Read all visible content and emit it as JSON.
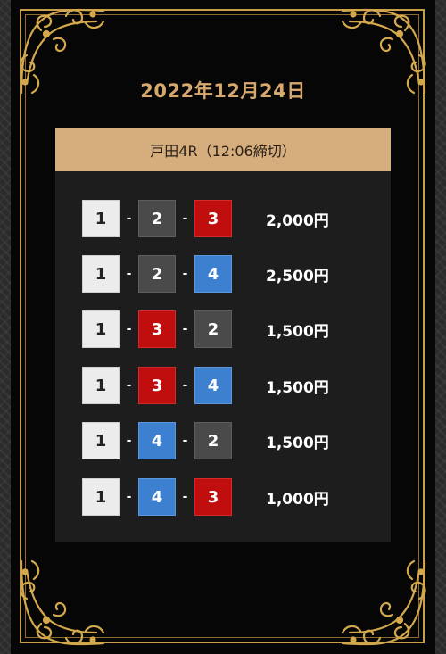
{
  "header": {
    "date": "2022年12月24日",
    "race": "戸田4R（12:06締切）"
  },
  "colors": {
    "gold": "#c9a04a",
    "header_bg": "#d6ad7c",
    "boat_1": "#ececec",
    "boat_2": "#4a4a4a",
    "boat_3": "#c00d0d",
    "boat_4": "#3d80d0"
  },
  "separator": "-",
  "bets": [
    {
      "combo": [
        "1",
        "2",
        "3"
      ],
      "amount": "2,000円"
    },
    {
      "combo": [
        "1",
        "2",
        "4"
      ],
      "amount": "2,500円"
    },
    {
      "combo": [
        "1",
        "3",
        "2"
      ],
      "amount": "1,500円"
    },
    {
      "combo": [
        "1",
        "3",
        "4"
      ],
      "amount": "1,500円"
    },
    {
      "combo": [
        "1",
        "4",
        "2"
      ],
      "amount": "1,500円"
    },
    {
      "combo": [
        "1",
        "4",
        "3"
      ],
      "amount": "1,000円"
    }
  ]
}
